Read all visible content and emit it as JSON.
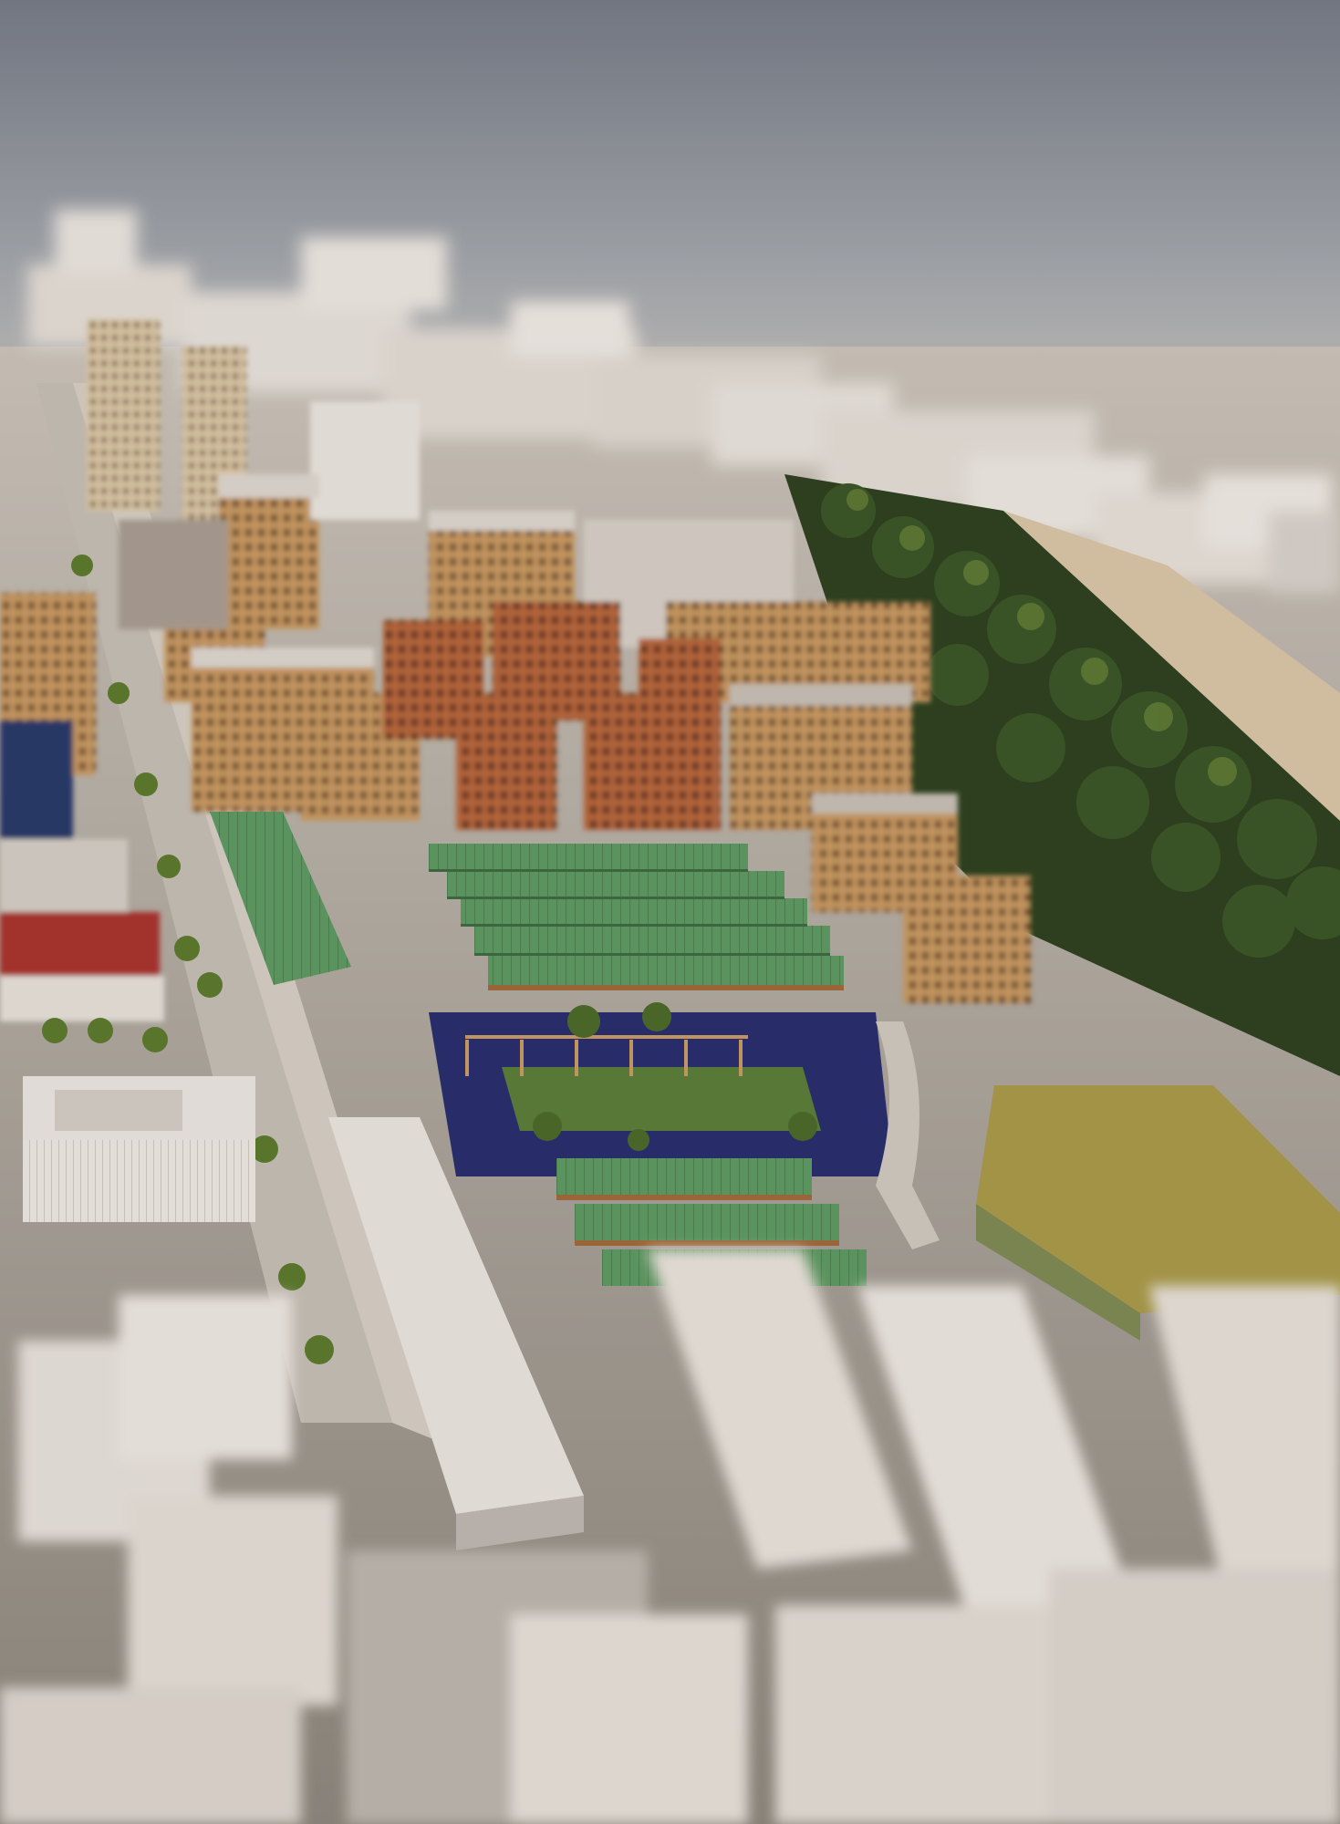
{
  "image": {
    "kind": "aerial-architectural-rendering",
    "style": "tilt-shift",
    "visible_text": []
  },
  "palette": {
    "sky_top": "#7d828c",
    "sky_haze": "#c9c6c2",
    "block_white": "#e8e2dc",
    "block_shadow": "#b9b2ac",
    "brick_tan": "#c99a63",
    "brick_red": "#b8683d",
    "green_roof": "#5f9a62",
    "lawn": "#5c7d3a",
    "courtyard_blue": "#2a2f6e",
    "tree_dark": "#2f4220",
    "tree_light": "#6f8a3c",
    "road": "#b8b4ad",
    "red_roof": "#a9362d",
    "olive_roof": "#a99a4a"
  }
}
